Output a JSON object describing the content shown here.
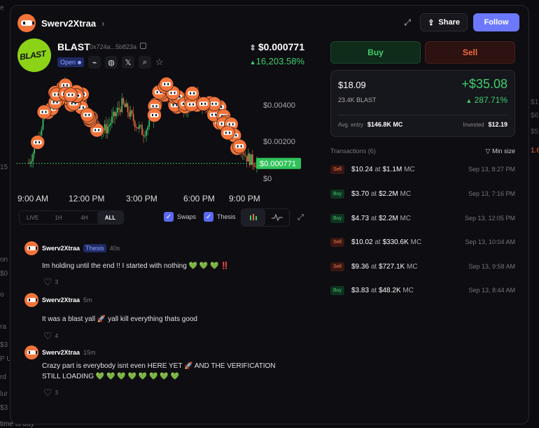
{
  "background": {
    "left_fragments": [
      "e",
      "15",
      "on",
      "$0",
      "o",
      "ra",
      "P U",
      "rd",
      "$3",
      "lur",
      "$3"
    ],
    "right_fragments": [
      "$1",
      "$6",
      "$5",
      "1.6"
    ],
    "bottom_text": "time to buy"
  },
  "header": {
    "username": "Swerv2Xtraa",
    "share_label": "Share",
    "follow_label": "Follow"
  },
  "token": {
    "name": "BLAST",
    "logo_text": "BLAST",
    "address": "0x724a...5b823a",
    "status": "Open",
    "price": "$0.000771",
    "change": "16,203.58%",
    "accent_green": "#3fcf6a",
    "accent_red": "#f26a40"
  },
  "chart_data": {
    "type": "candlestick",
    "y_ticks": [
      "$0.00400",
      "$0.00200",
      "$0"
    ],
    "x_ticks": [
      "9:00 AM",
      "12:00 PM",
      "3:00 PM",
      "6:00 PM",
      "9:00 PM"
    ],
    "current_label": "$0.000771",
    "current_value": 0.000771,
    "ylim": [
      0,
      0.0047
    ],
    "price_path": [
      0.0008,
      0.0014,
      0.0022,
      0.0031,
      0.0036,
      0.0039,
      0.0042,
      0.0044,
      0.0041,
      0.0039,
      0.004,
      0.0036,
      0.0031,
      0.0028,
      0.0024,
      0.0025,
      0.0029,
      0.0033,
      0.0037,
      0.0034,
      0.003,
      0.0026,
      0.0023,
      0.0026,
      0.0033,
      0.004,
      0.0045,
      0.0043,
      0.004,
      0.0037,
      0.0035,
      0.0038,
      0.0041,
      0.0039,
      0.0036,
      0.0034,
      0.0035,
      0.0031,
      0.0027,
      0.0024,
      0.002,
      0.0016,
      0.0011,
      0.0009,
      0.0008
    ]
  },
  "controls": {
    "ranges": [
      "LIVE",
      "1H",
      "4H",
      "ALL"
    ],
    "active_range": "ALL",
    "swaps_label": "Swaps",
    "thesis_label": "Thesis"
  },
  "comments": [
    {
      "author": "Swerv2Xtraa",
      "tag": "Thesis",
      "time": "40s",
      "text": "Im holding until the end !! I started with nothing 💚 💚 💚 ‼️",
      "likes": "3"
    },
    {
      "author": "Swerv2Xtraa",
      "tag": "",
      "time": "5m",
      "text": "It was a blast yall 🚀 yall kill everything thats good",
      "likes": "4"
    },
    {
      "author": "Swerv2Xtraa",
      "tag": "",
      "time": "15m",
      "text": "Crazy part is everybody isnt even HERE YET 🚀 AND THE VERIFICATION STILL LOADING 💚 💚 💚 💚 💚 💚 💚 💚",
      "likes": "3"
    }
  ],
  "trade": {
    "buy_label": "Buy",
    "sell_label": "Sell"
  },
  "position": {
    "value": "$18.09",
    "amount": "23.4K BLAST",
    "pnl": "+$35.08",
    "pnl_pct": "287.71%",
    "avg_entry_label": "Avg. entry",
    "avg_entry": "$146.8K MC",
    "invested_label": "Invested",
    "invested": "$12.19"
  },
  "transactions": {
    "title": "Transactions (6)",
    "filter_label": "Min size",
    "at_word": "at",
    "mc_word": "MC",
    "rows": [
      {
        "type": "Sell",
        "amount": "$10.24",
        "mc": "$1.1M",
        "time": "Sep 13, 8:27 PM"
      },
      {
        "type": "Buy",
        "amount": "$3.70",
        "mc": "$2.2M",
        "time": "Sep 13, 7:16 PM"
      },
      {
        "type": "Buy",
        "amount": "$4.73",
        "mc": "$2.2M",
        "time": "Sep 13, 12:05 PM"
      },
      {
        "type": "Sell",
        "amount": "$10.02",
        "mc": "$330.6K",
        "time": "Sep 13, 10:04 AM"
      },
      {
        "type": "Sell",
        "amount": "$9.36",
        "mc": "$727.1K",
        "time": "Sep 13, 9:58 AM"
      },
      {
        "type": "Buy",
        "amount": "$3.83",
        "mc": "$48.2K",
        "time": "Sep 13, 8:44 AM"
      }
    ]
  }
}
